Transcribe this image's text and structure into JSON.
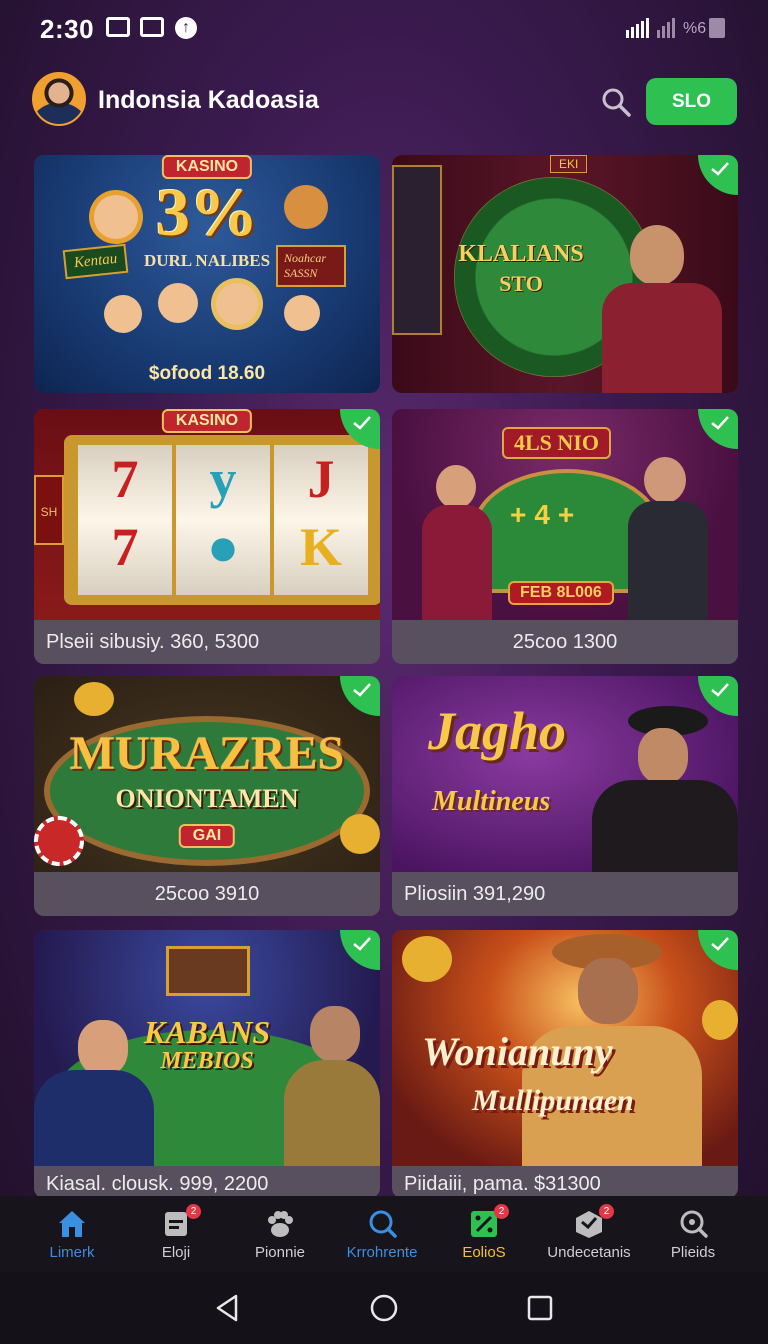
{
  "status_bar": {
    "time": "2:30",
    "signal_label": "%6",
    "icons": [
      "sim-icon",
      "message-icon",
      "upload-icon",
      "signal-icon",
      "battery-icon"
    ]
  },
  "header": {
    "title": "Indonsia Kadoasia",
    "action_button": "SLO",
    "search_icon": "search-icon"
  },
  "cards": [
    {
      "art_texts": [
        "KASINO",
        "3%",
        "DURL NALIBES",
        "Kentau",
        "Noahcar SASSN",
        "$ofood 18.60"
      ],
      "caption": "",
      "checked": false
    },
    {
      "art_texts": [
        "EKI",
        "KLALIANS",
        "STO"
      ],
      "caption": "",
      "checked": true
    },
    {
      "art_texts": [
        "KASINO",
        "SH"
      ],
      "caption": "Plseii sibusiy. 360, 5300",
      "checked": true
    },
    {
      "art_texts": [
        "4LS NIO",
        "FEB 8L006"
      ],
      "caption": "25coo 1300",
      "checked": true
    },
    {
      "art_texts": [
        "MURAZRES",
        "ONIONTAMEN",
        "GAI"
      ],
      "caption": "25coo 3910",
      "checked": true
    },
    {
      "art_texts": [
        "Jagho",
        "Multineus"
      ],
      "caption": "Pliosiin 391,290",
      "checked": true
    },
    {
      "art_texts": [
        "KABANS",
        "MEBIOS"
      ],
      "caption": "Kiasal. clousk. 999, 2200",
      "checked": true
    },
    {
      "art_texts": [
        "Wonianuny",
        "Mullipunaen"
      ],
      "caption": "Piidaiii, pama. $31300",
      "checked": true
    }
  ],
  "bottom_nav": [
    {
      "label": "Limerk",
      "icon": "home-icon",
      "active": true,
      "badge": ""
    },
    {
      "label": "Eloji",
      "icon": "document-icon",
      "active": false,
      "badge": "2"
    },
    {
      "label": "Pionnie",
      "icon": "paw-icon",
      "active": false,
      "badge": ""
    },
    {
      "label": "Krrohrente",
      "icon": "search-circle-icon",
      "active": true,
      "badge": ""
    },
    {
      "label": "EolioS",
      "icon": "game-icon",
      "active": true,
      "badge": "2"
    },
    {
      "label": "Undecetanis",
      "icon": "box-icon",
      "active": false,
      "badge": "2"
    },
    {
      "label": "Plieids",
      "icon": "search-plus-icon",
      "active": false,
      "badge": ""
    }
  ],
  "system_nav": [
    "back-icon",
    "home-circle-icon",
    "recents-icon"
  ],
  "colors": {
    "accent_green": "#2ec050",
    "nav_active_blue": "#3b8fe0",
    "nav_active_yellow": "#f2c12e",
    "badge_red": "#e23848"
  }
}
